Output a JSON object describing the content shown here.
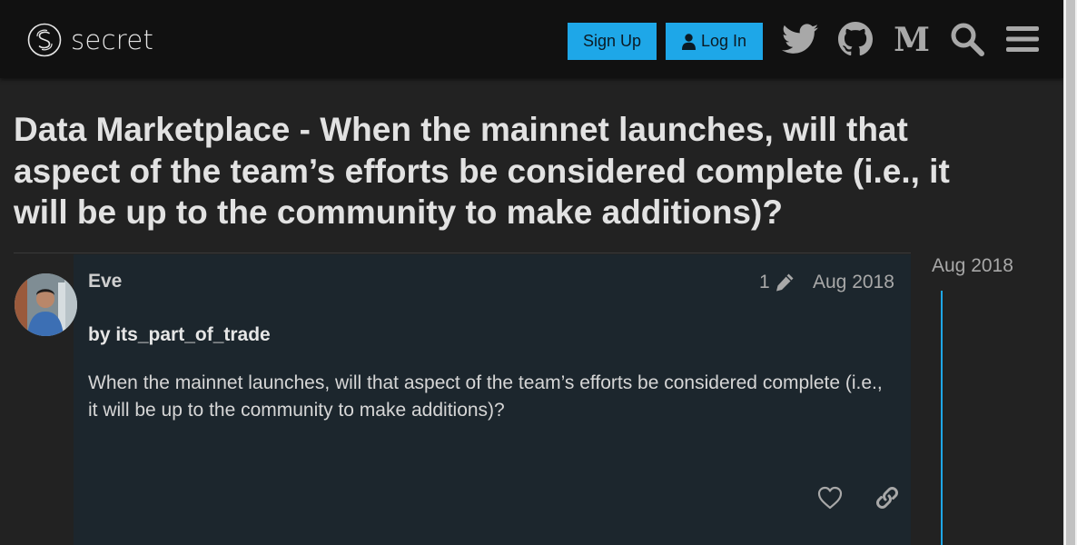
{
  "header": {
    "logo_text": "secret",
    "signup_label": "Sign Up",
    "login_label": "Log In",
    "icons": [
      "twitter-icon",
      "github-icon",
      "medium-icon",
      "search-icon",
      "hamburger-menu-icon"
    ]
  },
  "topic": {
    "title": "Data Marketplace - When the mainnet launches, will that aspect of the team’s efforts be considered complete (i.e., it will be up to the community to make additions)?"
  },
  "post": {
    "username": "Eve",
    "edit_count": "1",
    "date": "Aug 2018",
    "byline": "by its_part_of_trade",
    "body": "When the mainnet launches, will that aspect of the team’s efforts be considered complete (i.e., it will be up to the community to make additions)?"
  },
  "timeline": {
    "date": "Aug 2018"
  },
  "colors": {
    "accent": "#1ea7e8",
    "header_bg": "#111111",
    "page_bg": "#222222",
    "post_bg": "#1c262d"
  }
}
